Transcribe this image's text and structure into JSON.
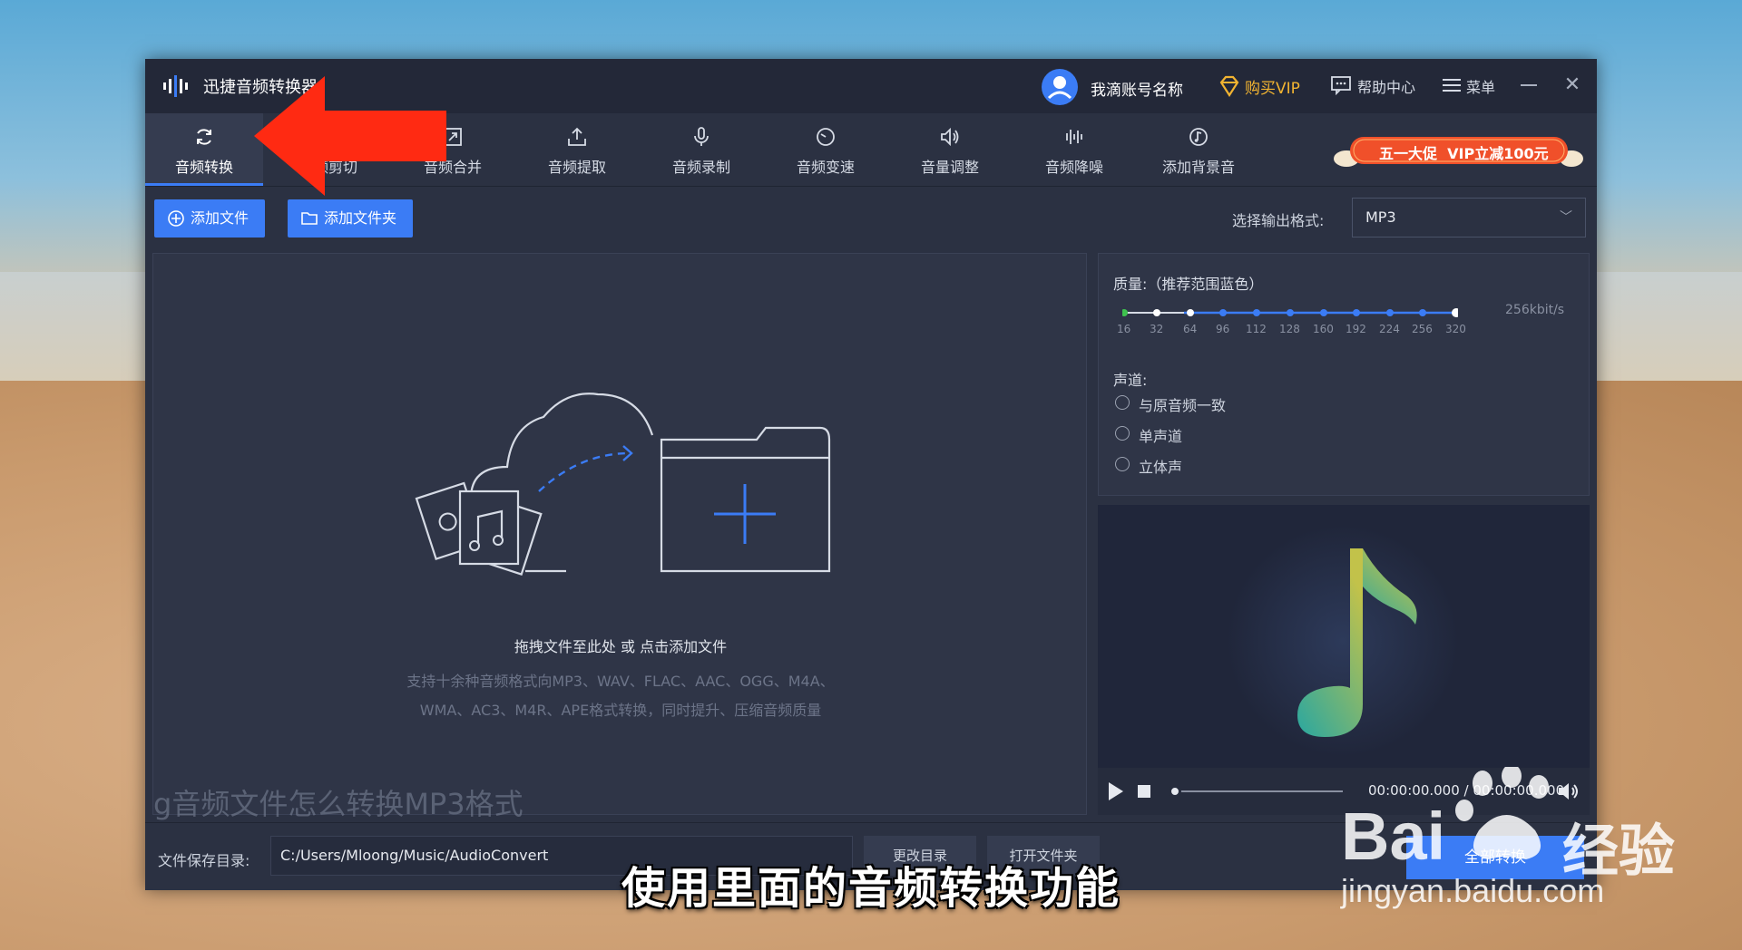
{
  "app": {
    "title": "迅捷音频转换器",
    "account_name": "我滴账号名称",
    "buy_vip": "购买VIP",
    "help": "帮助中心",
    "menu": "菜单"
  },
  "tabs": [
    {
      "label": "音频转换",
      "icon": "refresh-icon"
    },
    {
      "label": "音频剪切",
      "icon": "scissors-icon"
    },
    {
      "label": "音频合并",
      "icon": "merge-icon"
    },
    {
      "label": "音频提取",
      "icon": "upload-icon"
    },
    {
      "label": "音频录制",
      "icon": "microphone-icon"
    },
    {
      "label": "音频变速",
      "icon": "speed-icon"
    },
    {
      "label": "音量调整",
      "icon": "volume-icon"
    },
    {
      "label": "音频降噪",
      "icon": "noise-icon"
    },
    {
      "label": "添加背景音",
      "icon": "music-add-icon"
    }
  ],
  "promo": "五一大促  VIP立减100元",
  "actions": {
    "add_file": "添加文件",
    "add_folder": "添加文件夹",
    "format_label": "选择输出格式:",
    "format_value": "MP3"
  },
  "dropzone": {
    "title": "拖拽文件至此处 或 点击添加文件",
    "desc_line1": "支持十余种音频格式向MP3、WAV、FLAC、AAC、OGG、M4A、",
    "desc_line2": "WMA、AC3、M4R、APE格式转换，同时提升、压缩音频质量"
  },
  "watermark_title": "g音频文件怎么转换MP3格式",
  "settings": {
    "quality_label": "质量:（推荐范围蓝色）",
    "bitrates": [
      "16",
      "32",
      "64",
      "96",
      "112",
      "128",
      "160",
      "192",
      "224",
      "256",
      "320"
    ],
    "selected_bitrate": "256kbit/s",
    "channel_label": "声道:",
    "channels": [
      "与原音频一致",
      "单声道",
      "立体声"
    ]
  },
  "player": {
    "time": "00:00:00.000 / 00:00:00.000"
  },
  "bottom": {
    "path_label": "文件保存目录:",
    "path_value": "C:/Users/Mloong/Music/AudioConvert",
    "change_dir": "更改目录",
    "open_folder": "打开文件夹",
    "convert_all": "全部转换"
  },
  "subtitle": "使用里面的音频转换功能",
  "baidu": {
    "brand": "Bai",
    "jingyan": "经验",
    "url": "jingyan.baidu.com"
  },
  "colors": {
    "accent": "#3b7cf5",
    "vip": "#f2b431",
    "arrow": "#ff2a12",
    "promo": "#f0502a"
  }
}
